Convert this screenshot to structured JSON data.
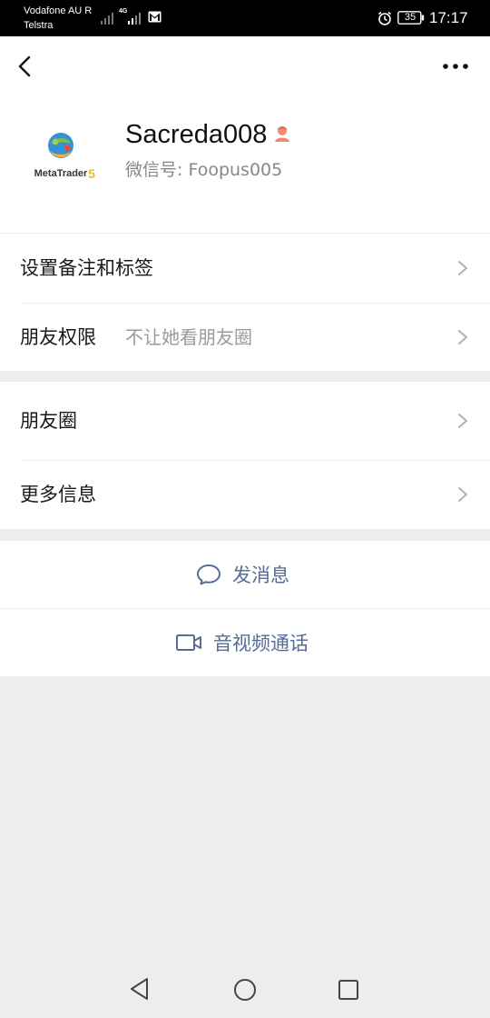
{
  "status_bar": {
    "carrier_line1": "Vodafone AU R",
    "carrier_line2": "Telstra",
    "network": "4G",
    "battery": "35",
    "time": "17:17"
  },
  "profile": {
    "name": "Sacreda008",
    "wechat_id_label": "微信号:",
    "wechat_id_value": "Foopus005",
    "avatar_text": "MetaTrader 5",
    "gender": "female"
  },
  "section1": {
    "rows": [
      {
        "label": "设置备注和标签",
        "value": ""
      },
      {
        "label": "朋友权限",
        "value": "不让她看朋友圈"
      }
    ]
  },
  "section2": {
    "rows": [
      {
        "label": "朋友圈"
      },
      {
        "label": "更多信息"
      }
    ]
  },
  "actions": {
    "message_label": "发消息",
    "call_label": "音视频通话"
  },
  "icons": {
    "back": "chevron-left-icon",
    "more": "more-dots-icon",
    "chevron": "chevron-right-icon",
    "message": "chat-bubble-icon",
    "call": "video-camera-icon"
  },
  "colors": {
    "link": "#576b95",
    "background": "#ededed",
    "card": "#ffffff"
  }
}
